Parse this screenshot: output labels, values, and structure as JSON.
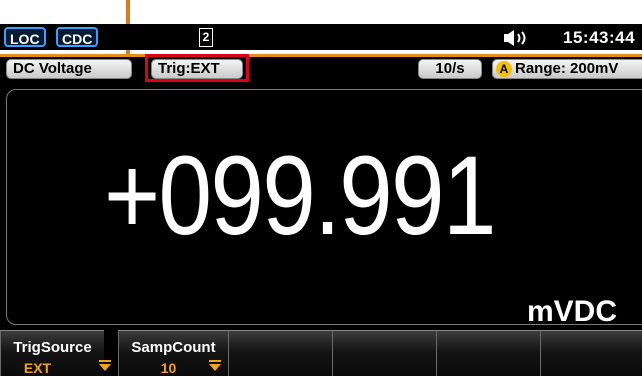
{
  "status": {
    "loc_label": "LOC",
    "cdc_label": "CDC",
    "memory_label": "2",
    "time": "15:43:44"
  },
  "info": {
    "function_label": "DC Voltage",
    "trigger_label": "Trig:EXT",
    "rate_label": "10/s",
    "auto_badge": "A",
    "range_label": "Range: 200mV"
  },
  "measurement": {
    "reading": "+099.991",
    "unit": "mVDC"
  },
  "softkeys": [
    {
      "label": "TrigSource",
      "value": "EXT"
    },
    {
      "label": "SampCount",
      "value": "10"
    },
    {
      "label": "",
      "value": ""
    },
    {
      "label": "",
      "value": ""
    },
    {
      "label": "",
      "value": ""
    },
    {
      "label": "",
      "value": ""
    },
    {
      "label": "",
      "value": ""
    }
  ],
  "colors": {
    "accent_orange": "#e58c1a",
    "highlight_red": "#e0001a",
    "softkey_value": "#f2a21a",
    "auto_badge": "#f2c200"
  },
  "icons": {
    "memory": "memory-icon",
    "speaker": "speaker-icon",
    "dropdown": "dropdown-arrow-icon"
  }
}
